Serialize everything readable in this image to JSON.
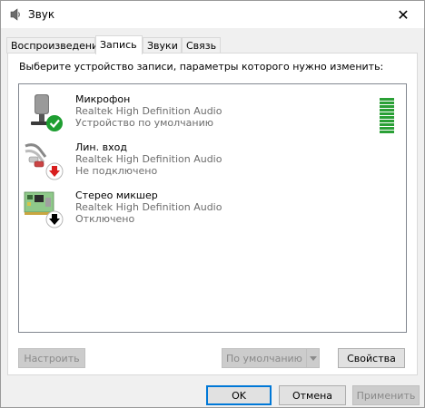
{
  "window": {
    "title": "Звук",
    "close_glyph": "✕"
  },
  "tabs": [
    {
      "label": "Воспроизведение",
      "active": false
    },
    {
      "label": "Запись",
      "active": true
    },
    {
      "label": "Звуки",
      "active": false
    },
    {
      "label": "Связь",
      "active": false
    }
  ],
  "prompt": "Выберите устройство записи, параметры которого нужно изменить:",
  "devices": [
    {
      "name": "Микрофон",
      "driver": "Realtek High Definition Audio",
      "status": "Устройство по умолчанию",
      "icon": "microphone-icon",
      "badge": "check-badge-icon",
      "badge_color": "#1e9e31"
    },
    {
      "name": "Лин. вход",
      "driver": "Realtek High Definition Audio",
      "status": "Не подключено",
      "icon": "line-in-icon",
      "badge": "down-arrow-red-badge-icon",
      "badge_color": "#d81e1e"
    },
    {
      "name": "Стерео микшер",
      "driver": "Realtek High Definition Audio",
      "status": "Отключено",
      "icon": "stereo-mixer-icon",
      "badge": "down-arrow-black-badge-icon",
      "badge_color": "#000000"
    }
  ],
  "level_meter": {
    "color": "#2aa036",
    "level": 1.0
  },
  "buttons": {
    "configure": "Настроить",
    "set_default": "По умолчанию",
    "properties": "Свойства",
    "ok": "OK",
    "cancel": "Отмена",
    "apply": "Применить"
  }
}
